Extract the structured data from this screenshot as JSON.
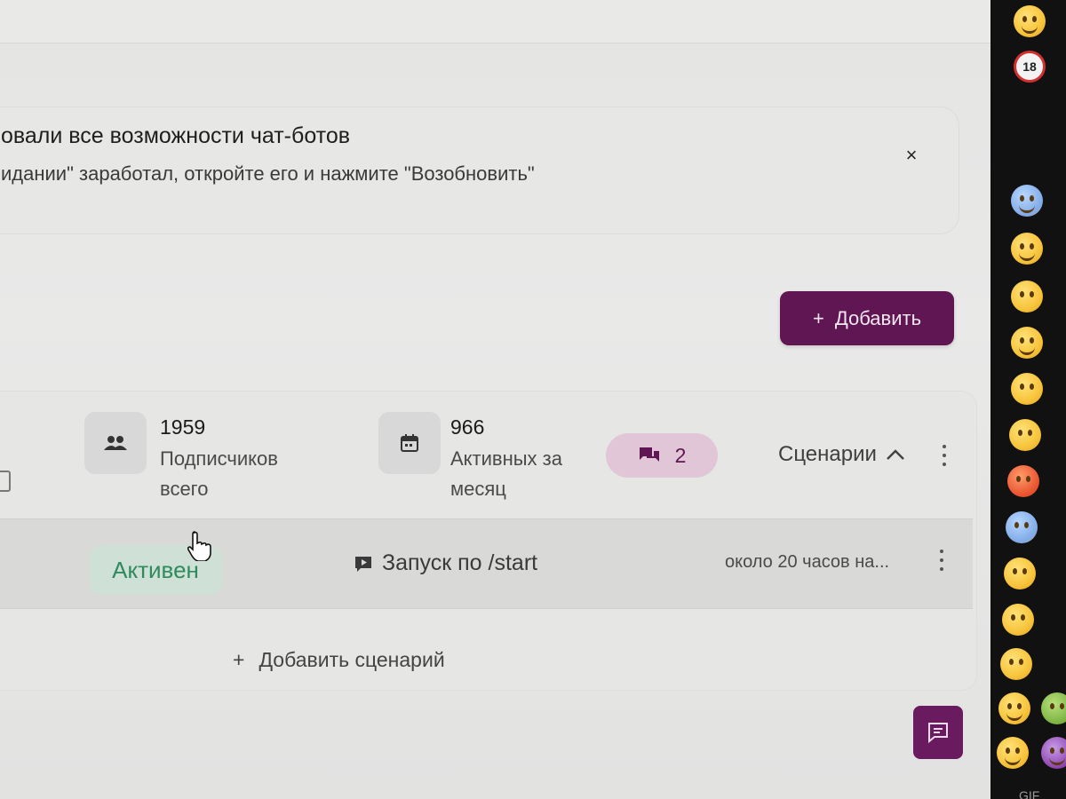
{
  "notice": {
    "title": "овали все возможности чат-ботов",
    "text": "идании\" заработал, откройте его и нажмите \"Возобновить\"",
    "close_symbol": "×"
  },
  "toolbar": {
    "add_symbol": "+",
    "add_label": "Добавить"
  },
  "bot_card": {
    "subscribers": {
      "value": "1959",
      "label": "Подписчиков всего",
      "icon": "people-icon"
    },
    "active": {
      "value": "966",
      "label": "Активных за месяц",
      "icon": "calendar-icon"
    },
    "chats": {
      "count": "2",
      "icon": "chat-icon"
    },
    "scenarios_label": "Сценарии",
    "scenarios_toggle_icon": "chevron-up-icon"
  },
  "scenario_row": {
    "status": "Активен",
    "trigger": "Запуск по /start",
    "trigger_icon": "play-icon",
    "updated": "около 20 часов на..."
  },
  "add_scenario": {
    "symbol": "+",
    "label": "Добавить сценарий"
  },
  "colors": {
    "brand": "#5f1653",
    "status_active_bg": "#cfe0d6",
    "status_active_text": "#2f8a5c",
    "chat_pill_bg": "#e0c6d6"
  },
  "emoji_panel": {
    "label": "GIF",
    "icons": [
      "grinning-emoji",
      "no-under-18-emoji",
      "sweat-smile-emoji",
      "smile-emoji",
      "kissing-emoji",
      "monocle-emoji",
      "disappointed-emoji",
      "tired-emoji",
      "angry-emoji",
      "anxious-emoji",
      "hand-over-mouth-emoji",
      "astonished-emoji",
      "yawning-emoji",
      "woozy-emoji",
      "cowboy-emoji"
    ]
  }
}
